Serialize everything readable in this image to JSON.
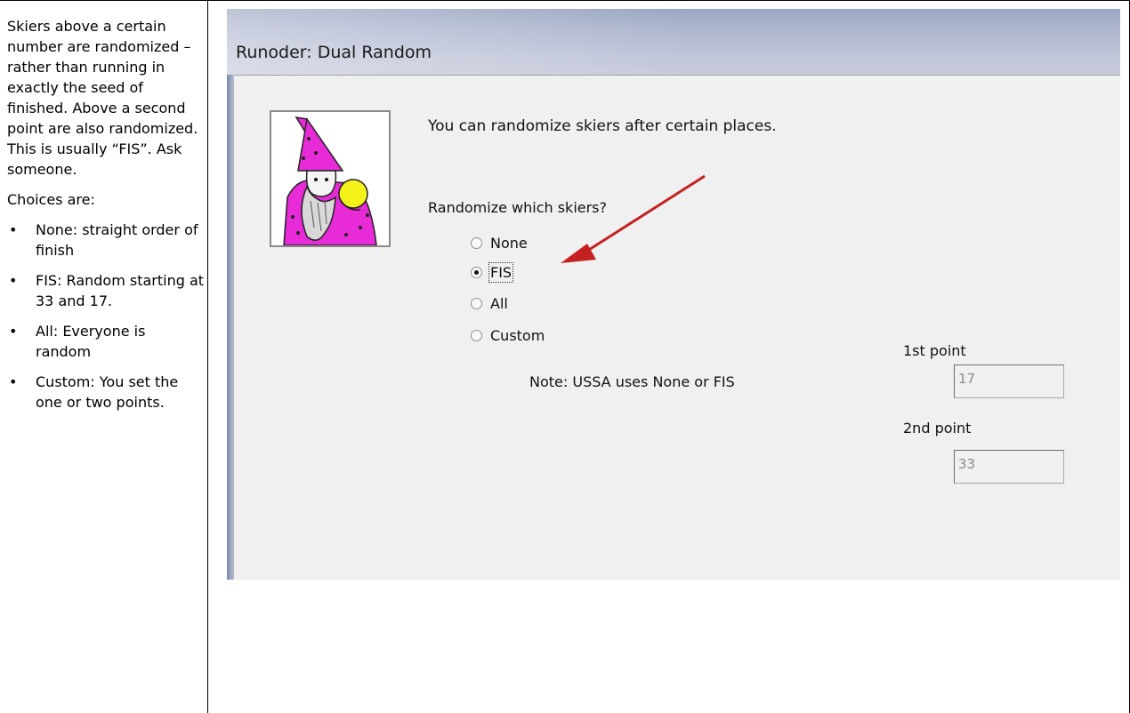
{
  "notes": {
    "intro": "Skiers above a certain number are randomized – rather than running in exactly the seed of finished. Above a second point are also randomized. This is usually “FIS”. Ask someone.",
    "choices_heading": "Choices are:",
    "bullets": [
      "None: straight order of finish",
      "FIS: Random starting at 33 and 17.",
      "All: Everyone is random",
      "Custom: You set the one or two points."
    ]
  },
  "dialog": {
    "title": "Runoder: Dual Random",
    "instruction": "You can randomize skiers after certain places.",
    "question": "Randomize which skiers?",
    "options": [
      {
        "label": "None",
        "selected": false
      },
      {
        "label": "FIS",
        "selected": true
      },
      {
        "label": "All",
        "selected": false
      },
      {
        "label": "Custom",
        "selected": false
      }
    ],
    "note": "Note: USSA uses None or FIS",
    "first_point": {
      "label": "1st point",
      "value": "17"
    },
    "second_point": {
      "label": "2nd point",
      "value": "33"
    }
  },
  "colors": {
    "arrow": "#c42020",
    "wizard_robe": "#e62bd7",
    "crystal_ball": "#f5f21a"
  }
}
